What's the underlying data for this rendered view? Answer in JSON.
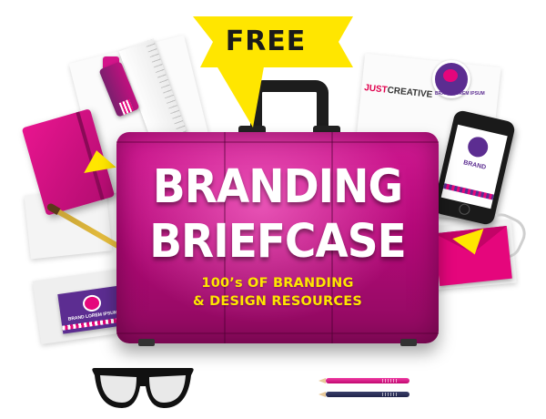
{
  "promo": {
    "ribbon_label": "FREE",
    "title_line1": "BRANDING",
    "title_line2": "BRIEFCASE",
    "subtitle_line1": "100’s OF BRANDING",
    "subtitle_line2": "& DESIGN RESOURCES"
  },
  "props": {
    "letterhead_logo_part1": "JUST",
    "letterhead_logo_part2": "CREATIVE",
    "phone_label": "BRAND",
    "card_label": "BRAND LOREM IPSUM",
    "badge_label": "BRAND LOREM IPSUM"
  },
  "colors": {
    "briefcase": "#b6097a",
    "ribbon": "#ffe600",
    "brand_purple": "#5c2d91",
    "brand_pink": "#e5067c"
  }
}
